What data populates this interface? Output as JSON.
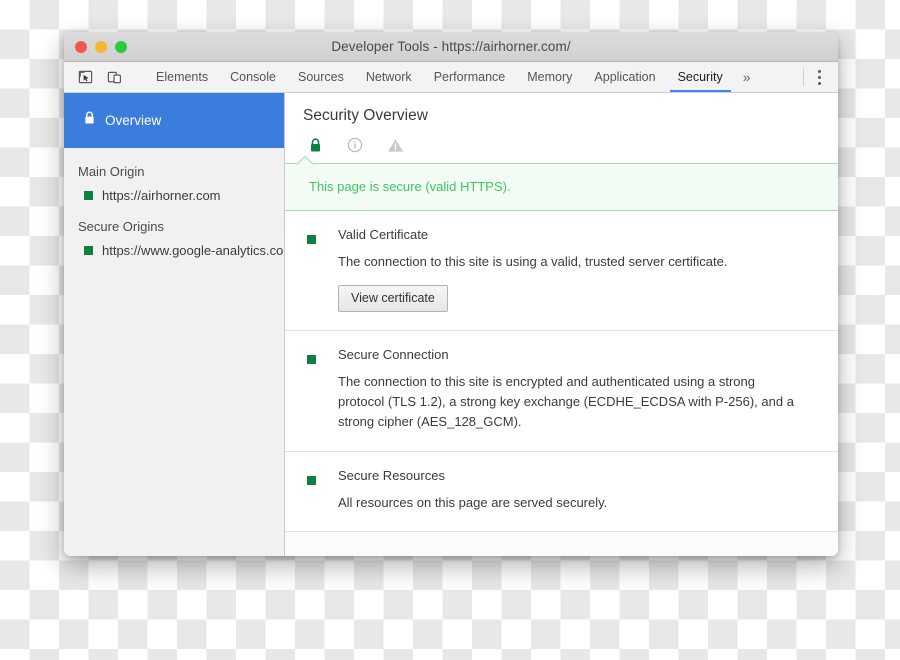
{
  "window": {
    "title": "Developer Tools - https://airhorner.com/",
    "traffic_lights": [
      "close",
      "minimize",
      "zoom"
    ]
  },
  "toolbar": {
    "inspect_icon": "inspect-element-icon",
    "device_icon": "device-toolbar-icon",
    "tabs": [
      {
        "label": "Elements",
        "active": false
      },
      {
        "label": "Console",
        "active": false
      },
      {
        "label": "Sources",
        "active": false
      },
      {
        "label": "Network",
        "active": false
      },
      {
        "label": "Performance",
        "active": false
      },
      {
        "label": "Memory",
        "active": false
      },
      {
        "label": "Application",
        "active": false
      },
      {
        "label": "Security",
        "active": true
      }
    ],
    "more_tabs_label": "»",
    "menu_icon": "kebab-menu-icon"
  },
  "sidebar": {
    "overview": {
      "label": "Overview",
      "icon": "lock-icon"
    },
    "groups": [
      {
        "title": "Main Origin",
        "origins": [
          {
            "url": "https://airhorner.com",
            "state": "secure"
          }
        ]
      },
      {
        "title": "Secure Origins",
        "origins": [
          {
            "url": "https://www.google-analytics.com",
            "state": "secure"
          }
        ]
      }
    ]
  },
  "main": {
    "title": "Security Overview",
    "state_icons": [
      {
        "name": "lock-icon",
        "state": "active"
      },
      {
        "name": "info-circle-icon",
        "state": "inactive"
      },
      {
        "name": "warning-triangle-icon",
        "state": "inactive"
      }
    ],
    "banner": {
      "text": "This page is secure (valid HTTPS)."
    },
    "sections": [
      {
        "title": "Valid Certificate",
        "description": "The connection to this site is using a valid, trusted server certificate.",
        "button": "View certificate"
      },
      {
        "title": "Secure Connection",
        "description": "The connection to this site is encrypted and authenticated using a strong protocol (TLS 1.2), a strong key exchange (ECDHE_ECDSA with P-256), and a strong cipher (AES_128_GCM)."
      },
      {
        "title": "Secure Resources",
        "description": "All resources on this page are served securely."
      }
    ]
  },
  "colors": {
    "accent_blue": "#3b7ddd",
    "tab_underline": "#4285f4",
    "secure_green": "#0e8043",
    "banner_text": "#41c463",
    "banner_bg": "#f2fbf4",
    "banner_border": "#9ddfae"
  }
}
